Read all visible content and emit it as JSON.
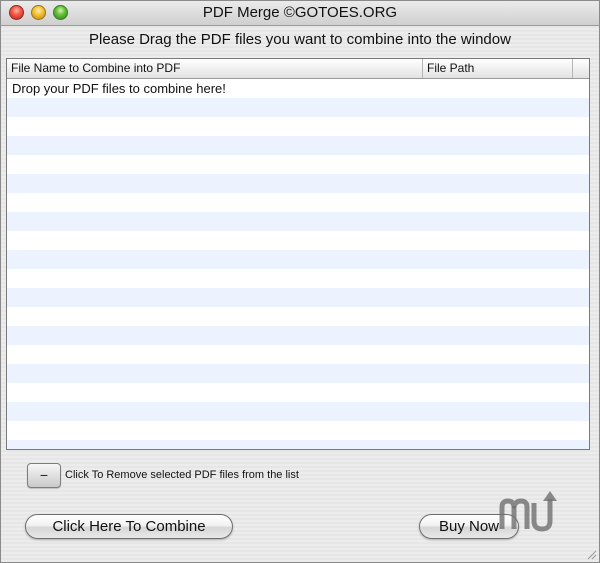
{
  "window": {
    "title": "PDF Merge ©GOTOES.ORG"
  },
  "instruction": "Please Drag the PDF files you want to combine into the window",
  "table": {
    "columns": [
      "File Name to Combine into PDF",
      "File Path"
    ],
    "placeholder_row": "Drop your PDF files to combine here!"
  },
  "remove": {
    "button_label": "−",
    "description": "Click To Remove selected PDF files from the list"
  },
  "buttons": {
    "combine": "Click Here To Combine",
    "buy": "Buy Now"
  },
  "icons": {
    "close": "close-icon",
    "minimize": "minimize-icon",
    "zoom": "zoom-icon",
    "watermark": "macupdate-logo-icon",
    "resize": "resize-grip-icon"
  }
}
